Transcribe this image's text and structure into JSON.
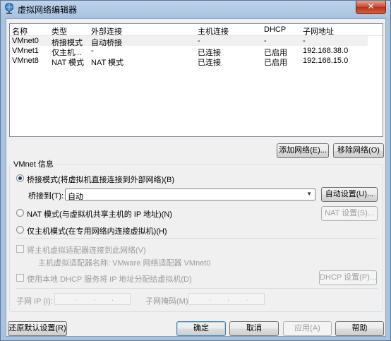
{
  "window": {
    "title": "虚拟网络编辑器",
    "close": "✕"
  },
  "table": {
    "headers": [
      "名称",
      "类型",
      "外部连接",
      "主机连接",
      "DHCP",
      "子网地址"
    ],
    "rows": [
      [
        "VMnet0",
        "桥接模式",
        "自动桥接",
        "-",
        "-",
        "-"
      ],
      [
        "VMnet1",
        "仅主机...",
        "-",
        "已连接",
        "已启用",
        "192.168.38.0"
      ],
      [
        "VMnet8",
        "NAT 模式",
        "NAT 模式",
        "已连接",
        "已启用",
        "192.168.15.0"
      ]
    ]
  },
  "buttons": {
    "add_network": "添加网络(E)...",
    "remove_network": "移除网络(O)",
    "auto_settings": "自动设置(U)...",
    "nat_settings": "NAT 设置(S)...",
    "dhcp_settings": "DHCP 设置(P)...",
    "restore_defaults": "还原默认设置(R)",
    "ok": "确定",
    "cancel": "取消",
    "apply": "应用(A)",
    "help": "帮助"
  },
  "vmnet_info": {
    "title": "VMnet 信息",
    "bridged_label": "桥接模式(将虚拟机直接连接到外部网络)(B)",
    "bridged_to_label": "桥接到(T):",
    "bridged_to_value": "自动",
    "nat_label": "NAT 模式(与虚拟机共享主机的 IP 地址)(N)",
    "host_only_label": "仅主机模式(在专用网络内连接虚拟机)(H)",
    "connect_adapter_label": "将主机虚拟适配器连接到此网络(V)",
    "adapter_name_label": "主机虚拟适配器名称: VMware 网络适配器 VMnet0",
    "dhcp_label": "使用本地 DHCP 服务将 IP 地址分配给虚拟机(D)",
    "subnet_ip_label": "子网 IP (I):",
    "subnet_mask_label": "子网掩码(M):",
    "ip_dots": ".",
    "selected_mode": "bridged"
  },
  "icons": {
    "app": "network-globe-icon",
    "dropdown": "chevron-down-icon"
  },
  "colors": {
    "selected_row": "#f0f0f0",
    "dialog_bg": "#f0f0f0",
    "frame": "#a9c3df"
  }
}
